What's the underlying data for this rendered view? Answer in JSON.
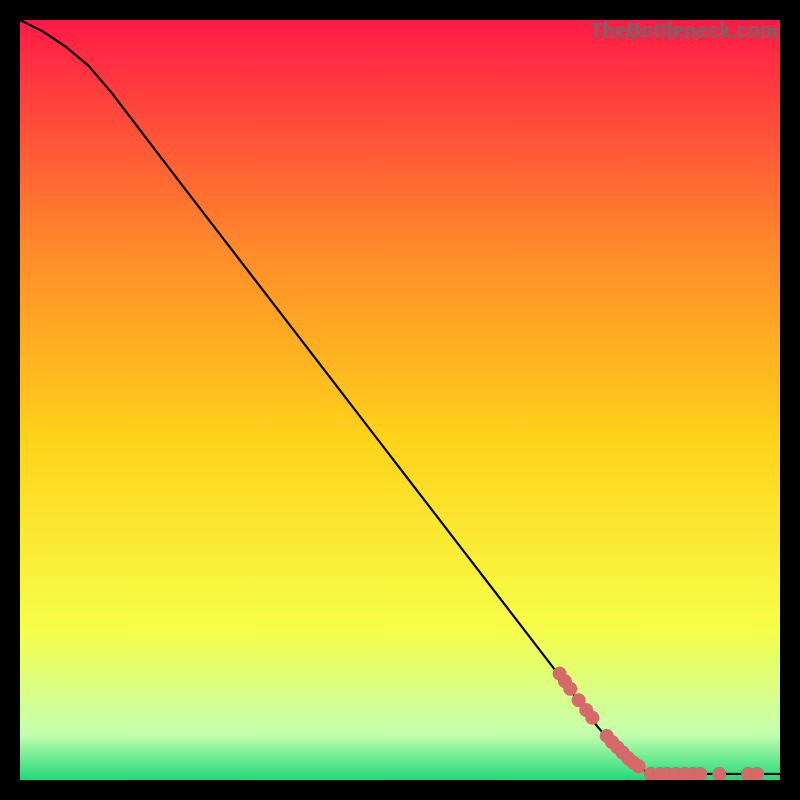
{
  "watermark": "TheBottleneck.com",
  "chart_data": {
    "type": "line",
    "title": "",
    "xlabel": "",
    "ylabel": "",
    "xlim": [
      0,
      100
    ],
    "ylim": [
      0,
      100
    ],
    "grid": false,
    "legend": false,
    "background_gradient": {
      "top": "#ff1a47",
      "upper_mid": "#ff8a2a",
      "mid": "#ffd21a",
      "lower_mid": "#f7ff4a",
      "near_bottom": "#c4ffb0",
      "bottom": "#1fd97a"
    },
    "series": [
      {
        "name": "curve",
        "points": [
          {
            "x": 0,
            "y": 100
          },
          {
            "x": 3,
            "y": 98.5
          },
          {
            "x": 6,
            "y": 96.5
          },
          {
            "x": 9,
            "y": 94
          },
          {
            "x": 12,
            "y": 90.5
          },
          {
            "x": 20,
            "y": 80
          },
          {
            "x": 30,
            "y": 67
          },
          {
            "x": 40,
            "y": 54
          },
          {
            "x": 50,
            "y": 41
          },
          {
            "x": 60,
            "y": 28
          },
          {
            "x": 70,
            "y": 15
          },
          {
            "x": 76,
            "y": 7
          },
          {
            "x": 80,
            "y": 2.5
          },
          {
            "x": 83,
            "y": 0.8
          },
          {
            "x": 100,
            "y": 0.8
          }
        ]
      }
    ],
    "markers": {
      "color": "#d66a6a",
      "radius_normalized": 0.9,
      "points": [
        {
          "x": 71,
          "y": 14.0
        },
        {
          "x": 71.7,
          "y": 13.0
        },
        {
          "x": 72.4,
          "y": 12.0
        },
        {
          "x": 73.5,
          "y": 10.5
        },
        {
          "x": 74.5,
          "y": 9.2
        },
        {
          "x": 75.3,
          "y": 8.2
        },
        {
          "x": 77.2,
          "y": 5.8
        },
        {
          "x": 77.9,
          "y": 5.0
        },
        {
          "x": 78.6,
          "y": 4.3
        },
        {
          "x": 79.3,
          "y": 3.6
        },
        {
          "x": 80.0,
          "y": 2.9
        },
        {
          "x": 80.7,
          "y": 2.3
        },
        {
          "x": 81.4,
          "y": 1.8
        },
        {
          "x": 83.0,
          "y": 0.8
        },
        {
          "x": 84.2,
          "y": 0.8
        },
        {
          "x": 85.2,
          "y": 0.8
        },
        {
          "x": 86.3,
          "y": 0.8
        },
        {
          "x": 87.5,
          "y": 0.8
        },
        {
          "x": 88.5,
          "y": 0.8
        },
        {
          "x": 89.5,
          "y": 0.8
        },
        {
          "x": 92.0,
          "y": 0.8
        },
        {
          "x": 95.8,
          "y": 0.8
        },
        {
          "x": 97.0,
          "y": 0.8
        }
      ]
    }
  }
}
